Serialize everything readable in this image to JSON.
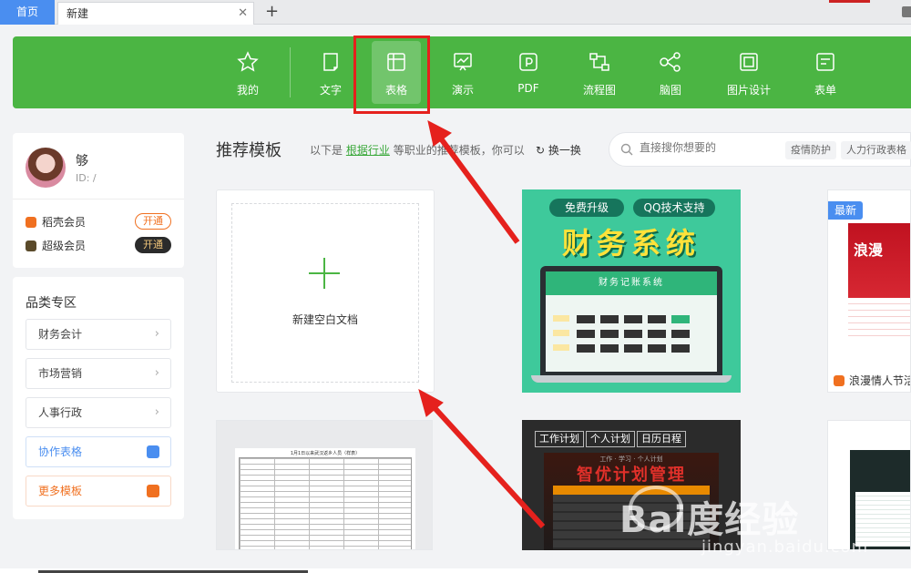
{
  "tabs": {
    "home_label": "首页",
    "new_label": "新建",
    "close_glyph": "✕",
    "add_glyph": "+"
  },
  "toolbar": {
    "items": [
      {
        "label": "我的",
        "icon": "star-icon"
      },
      {
        "label": "文字",
        "icon": "document-icon"
      },
      {
        "label": "表格",
        "icon": "spreadsheet-icon"
      },
      {
        "label": "演示",
        "icon": "presentation-icon"
      },
      {
        "label": "PDF",
        "icon": "pdf-icon"
      },
      {
        "label": "流程图",
        "icon": "flowchart-icon"
      },
      {
        "label": "脑图",
        "icon": "mindmap-icon"
      },
      {
        "label": "图片设计",
        "icon": "image-design-icon"
      },
      {
        "label": "表单",
        "icon": "form-icon"
      }
    ],
    "active": "表格",
    "bg_color": "#4bb543"
  },
  "user": {
    "name": "够",
    "id_prefix": "ID: /",
    "memberships": [
      {
        "label": "稻壳会员",
        "button": "开通",
        "icon_color": "#f07020"
      },
      {
        "label": "超级会员",
        "button": "开通",
        "icon_color": "#5a4a2a"
      }
    ]
  },
  "categories": {
    "title": "品类专区",
    "items": [
      {
        "label": "财务会计"
      },
      {
        "label": "市场营销"
      },
      {
        "label": "人事行政"
      },
      {
        "label": "协作表格"
      },
      {
        "label": "更多模板"
      }
    ]
  },
  "recommend": {
    "title": "推荐模板",
    "sub_prefix": "以下是",
    "sub_link": "根据行业",
    "sub_suffix": "等职业的推荐模板，你可以",
    "refresh": "换一换"
  },
  "search": {
    "placeholder": "直接搜你想要的",
    "chips": [
      "疫情防护",
      "人力行政表格"
    ]
  },
  "templates": {
    "blank_label": "新建空白文档",
    "finance": {
      "pill1": "免费升级",
      "pill2": "QQ技术支持",
      "title": "财务系统",
      "screen_title": "财务记账系统"
    },
    "vday": {
      "tag": "最新",
      "name": "浪漫情人节活"
    },
    "sheet_title": "1月1日以来武汉返乡人员（样表）",
    "plan": {
      "tags": [
        "工作计划",
        "个人计划",
        "日历日程"
      ],
      "sub": "工作 · 学习 · 个人计划",
      "title": "智优计划管理"
    }
  },
  "watermark": {
    "brand": "Bai度经验",
    "url": "jingyan.baidu.com"
  },
  "colors": {
    "accent_green": "#4bb543",
    "highlight_red": "#e5211d",
    "tab_blue": "#4a8ef0"
  }
}
